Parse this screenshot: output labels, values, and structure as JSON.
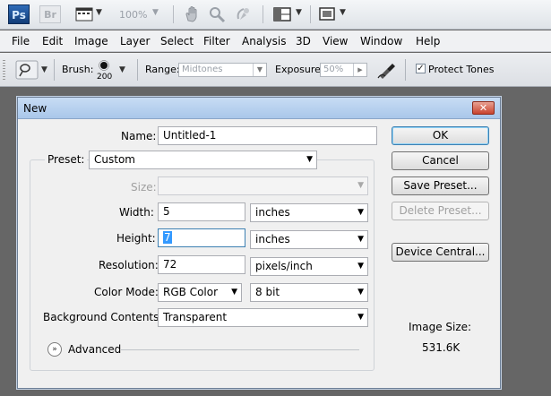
{
  "appbar": {
    "ps_logo": "Ps",
    "br_logo": "Br",
    "zoom": "100%"
  },
  "menu": [
    "File",
    "Edit",
    "Image",
    "Layer",
    "Select",
    "Filter",
    "Analysis",
    "3D",
    "View",
    "Window",
    "Help"
  ],
  "options": {
    "brush_label": "Brush:",
    "brush_size": "200",
    "range_label": "Range:",
    "range_value": "Midtones",
    "exposure_label": "Exposure:",
    "exposure_value": "50%",
    "protect_tones_label": "Protect Tones",
    "protect_tones_checked": true
  },
  "dialog": {
    "title": "New",
    "name_label": "Name:",
    "name_value": "Untitled-1",
    "preset_label": "Preset:",
    "preset_value": "Custom",
    "size_label": "Size:",
    "size_value": "",
    "width_label": "Width:",
    "width_value": "5",
    "width_unit": "inches",
    "height_label": "Height:",
    "height_value": "7",
    "height_unit": "inches",
    "resolution_label": "Resolution:",
    "resolution_value": "72",
    "resolution_unit": "pixels/inch",
    "color_mode_label": "Color Mode:",
    "color_mode_value": "RGB Color",
    "bit_depth_value": "8 bit",
    "background_label": "Background Contents:",
    "background_value": "Transparent",
    "advanced_label": "Advanced",
    "buttons": {
      "ok": "OK",
      "cancel": "Cancel",
      "save_preset": "Save Preset...",
      "delete_preset": "Delete Preset...",
      "device_central": "Device Central..."
    },
    "image_size_label": "Image Size:",
    "image_size_value": "531.6K"
  },
  "colors": {
    "workspace": "#666666",
    "titlebar": "#a9c7ea",
    "close_button": "#c9432e",
    "selection": "#3399ff"
  }
}
